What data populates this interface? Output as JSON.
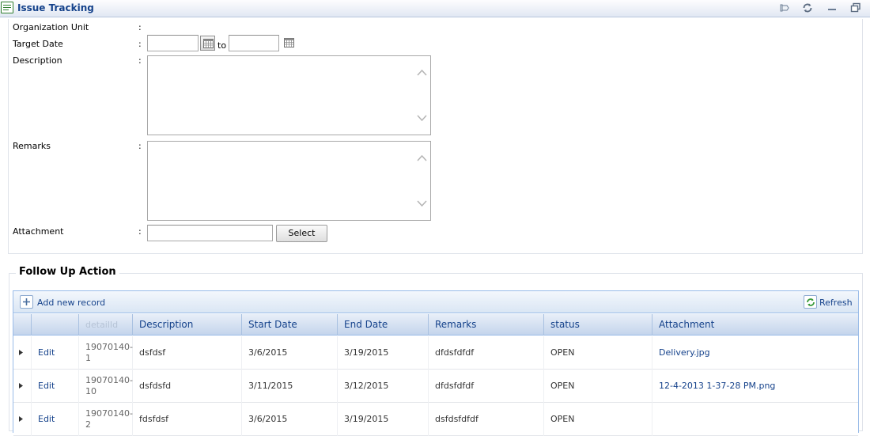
{
  "window": {
    "title": "Issue Tracking"
  },
  "form": {
    "org_unit_label": "Organization Unit",
    "target_date_label": "Target Date",
    "to_label": "to",
    "description_label": "Description",
    "remarks_label": "Remarks",
    "attachment_label": "Attachment",
    "colon": ":",
    "select_label": "Select"
  },
  "follow_up": {
    "legend": "Follow Up Action",
    "add_label": "Add new  record",
    "refresh_label": "Refresh",
    "columns": [
      "detailId",
      "Description",
      "Start Date",
      "End Date",
      "Remarks",
      "status",
      "Attachment"
    ],
    "edit_label": "Edit",
    "rows": [
      {
        "detail_id": "19070140-1",
        "description": "dsfdsf",
        "start": "3/6/2015",
        "end": "3/19/2015",
        "remarks": "dfdsfdfdf",
        "status": "OPEN",
        "attachment": "Delivery.jpg"
      },
      {
        "detail_id": "19070140-10",
        "description": "dsfdsfd",
        "start": "3/11/2015",
        "end": "3/12/2015",
        "remarks": "dfdsfdfdf",
        "status": "OPEN",
        "attachment": "12-4-2013 1-37-28 PM.png"
      },
      {
        "detail_id": "19070140-2",
        "description": "fdsfdsf",
        "start": "3/6/2015",
        "end": "3/19/2015",
        "remarks": "dsfdsfdfdf",
        "status": "OPEN",
        "attachment": ""
      }
    ]
  },
  "colors": {
    "header_text": "#15428b",
    "grid_border": "#99bbe8",
    "accent_green": "#2d7d2d"
  },
  "icons": [
    "window-list-icon",
    "pin-icon",
    "refresh-icon",
    "minimize-icon",
    "restore-icon",
    "calendar-icon",
    "plus-icon",
    "expand-arrow-icon"
  ]
}
